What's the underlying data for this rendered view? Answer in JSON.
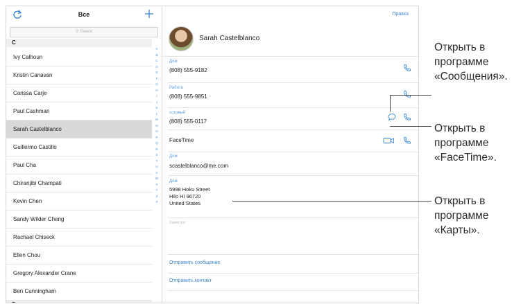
{
  "toolbar": {
    "title": "Все",
    "refresh_icon": "refresh-icon",
    "add_icon": "plus-icon"
  },
  "search": {
    "placeholder": "Поиск"
  },
  "sections": {
    "first": "C",
    "last": "E"
  },
  "contacts": [
    "Ivy Calhoun",
    "Kristin Canavan",
    "Carissa Carje",
    "Paul Cashman",
    "Sarah Castelblanco",
    "Guillermo Castillo",
    "Paul Cha",
    "Chiranjibi Champati",
    "Kevin Chen",
    "Sandy Wilder Cheng",
    "Rachael Chiseck",
    "Ellen Chou",
    "Gregory Alexander Crane",
    "Ben Cunningham"
  ],
  "selected_contact": "Sarah Castelblanco",
  "index": [
    "A",
    "B",
    "C",
    "D",
    "E",
    "F",
    "G",
    "H",
    "I",
    "J",
    "K",
    "L",
    "M",
    "N",
    "O",
    "P",
    "Q",
    "R",
    "S",
    "T",
    "U",
    "V",
    "W",
    "X",
    "Y",
    "Z",
    "#"
  ],
  "detail": {
    "edit": "Правка",
    "name": "Sarah Castelblanco",
    "phones": [
      {
        "label": "Дом",
        "value": "(808) 555-9182"
      },
      {
        "label": "Работа",
        "value": "(808) 555-9851"
      },
      {
        "label": "сотовый",
        "value": "(808) 555-0117"
      }
    ],
    "facetime": "FaceTime",
    "email": {
      "label": "Дом",
      "value": "scastelblanco@me.com"
    },
    "address": {
      "label": "Дом",
      "value": "5998 Hoku Street\nHilo HI 96720\nUnited States"
    },
    "notes_label": "Заметки",
    "send_message": "Отправить сообщение",
    "share_contact": "Отправить контакт"
  },
  "callouts": {
    "messages": "Открыть в\nпрограмме\n«Сообщения».",
    "facetime": "Открыть в\nпрограмме\n«FaceTime».",
    "maps": "Открыть в\nпрограмме\n«Карты»."
  },
  "colors": {
    "accent": "#3a86d4",
    "selected_row": "#d8d8d8",
    "section_bg": "#f0f0f0"
  }
}
